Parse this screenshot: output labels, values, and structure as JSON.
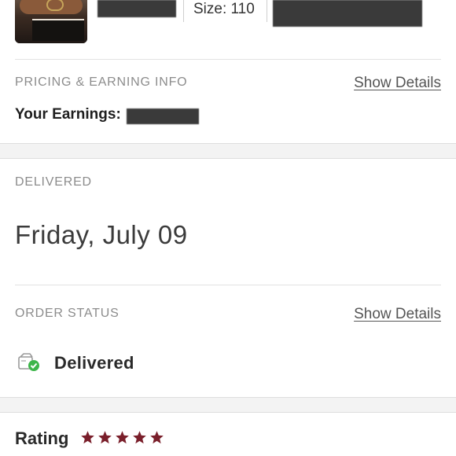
{
  "product": {
    "size_text": "Size: 110",
    "image_icon": "belt-box-thumbnail"
  },
  "pricing": {
    "section_label": "PRICING & EARNING INFO",
    "show_details_label": "Show Details",
    "earnings_label": "Your Earnings:"
  },
  "delivered": {
    "section_label": "DELIVERED",
    "date_text": "Friday, July 09"
  },
  "order_status": {
    "section_label": "ORDER STATUS",
    "show_details_label": "Show Details",
    "status_text": "Delivered",
    "status_icon": "delivered-check-icon",
    "status_color": "#3db54a"
  },
  "rating": {
    "label": "Rating",
    "stars": 5,
    "max_stars": 5,
    "star_color": "#7a1f2b"
  }
}
